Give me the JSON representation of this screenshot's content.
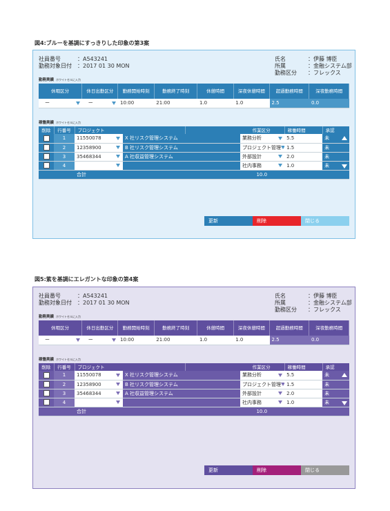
{
  "figures": [
    {
      "caption": "図4:ブルーを基調にすっきりした印象の第3案",
      "employee": {
        "id_label": "社員番号",
        "id_value": "：A543241",
        "date_label": "勤務対象日付",
        "date_value": "：2017 01 30 MON"
      },
      "info": {
        "name_label": "氏名",
        "name_value": "：伊藤 博臣",
        "dept_label": "所属",
        "dept_value": "：金融システム部",
        "type_label": "勤務区分",
        "type_value": "：フレックス"
      },
      "attendance": {
        "title": "勤務実績",
        "note": "ホワイトセルに入力",
        "headers": [
          "休暇区分",
          "休日出勤区分",
          "勤務開始時刻",
          "勤務終了時刻",
          "休憩時間",
          "深夜休憩時間",
          "超過勤務時間",
          "深夜勤務時間"
        ],
        "values": [
          "ー",
          "ー",
          "10:00",
          "21:00",
          "1.0",
          "1.0",
          "2.5",
          "0.0"
        ]
      },
      "work": {
        "title": "稼働実績",
        "note": "ホワイトセルに入力",
        "headers": [
          "削除",
          "行番号",
          "プロジェクト",
          "作業区分",
          "稼働時間",
          "承認"
        ],
        "rows": [
          {
            "num": "1",
            "code": "11550078",
            "project": "X 社リスク管理システム",
            "task": "業務分析",
            "hours": "5.5",
            "status": "未"
          },
          {
            "num": "2",
            "code": "12358900",
            "project": "B 社リスク管理システム",
            "task": "プロジェクト管理",
            "hours": "1.5",
            "status": "未"
          },
          {
            "num": "3",
            "code": "35468344",
            "project": "A 社収益管理システム",
            "task": "外部設計",
            "hours": "2.0",
            "status": "未"
          },
          {
            "num": "4",
            "code": "",
            "project": "",
            "task": "社内事務",
            "hours": "1.0",
            "status": "未"
          }
        ],
        "total_label": "合計",
        "total_value": "10.0"
      },
      "buttons": {
        "update": "更新",
        "delete": "削除",
        "close": "閉じる"
      }
    },
    {
      "caption": "図5:紫を基調にエレガントな印象の第4案",
      "employee": {
        "id_label": "社員番号",
        "id_value": "：A543241",
        "date_label": "勤務対象日付",
        "date_value": "：2017 01 30 MON"
      },
      "info": {
        "name_label": "氏名",
        "name_value": "：伊藤 博臣",
        "dept_label": "所属",
        "dept_value": "：金融システム部",
        "type_label": "勤務区分",
        "type_value": "：フレックス"
      },
      "attendance": {
        "title": "勤務実績",
        "note": "ホワイトセルに入力",
        "headers": [
          "休暇区分",
          "休日出勤区分",
          "勤務開始時刻",
          "勤務終了時刻",
          "休憩時間",
          "深夜休憩時間",
          "超過勤務時間",
          "深夜勤務時間"
        ],
        "values": [
          "ー",
          "ー",
          "10:00",
          "21:00",
          "1.0",
          "1.0",
          "2.5",
          "0.0"
        ]
      },
      "work": {
        "title": "稼働実績",
        "note": "ホワイトセルに入力",
        "headers": [
          "削除",
          "行番号",
          "プロジェクト",
          "作業区分",
          "稼働時間",
          "承認"
        ],
        "rows": [
          {
            "num": "1",
            "code": "11550078",
            "project": "X 社リスク管理システム",
            "task": "業務分析",
            "hours": "5.5",
            "status": "未"
          },
          {
            "num": "2",
            "code": "12358900",
            "project": "B 社リスク管理システム",
            "task": "プロジェクト管理",
            "hours": "1.5",
            "status": "未"
          },
          {
            "num": "3",
            "code": "35468344",
            "project": "A 社収益管理システム",
            "task": "外部設計",
            "hours": "2.0",
            "status": "未"
          },
          {
            "num": "4",
            "code": "",
            "project": "",
            "task": "社内事務",
            "hours": "1.0",
            "status": "未"
          }
        ],
        "total_label": "合計",
        "total_value": "10.0"
      },
      "buttons": {
        "update": "更新",
        "delete": "削除",
        "close": "閉じる"
      }
    }
  ],
  "colors": {
    "blue_panel_bg": "#e2f0fa",
    "blue_header": "#2c7fb6",
    "blue_delete": "#e8262b",
    "blue_close": "#8bd0ee",
    "purple_panel_bg": "#e4e2f1",
    "purple_header": "#5f4f9f",
    "purple_delete": "#a4207a",
    "purple_close": "#999999"
  },
  "icons": [
    "dropdown-arrow-icon",
    "checkbox",
    "scroll-up-icon",
    "scroll-down-icon"
  ]
}
